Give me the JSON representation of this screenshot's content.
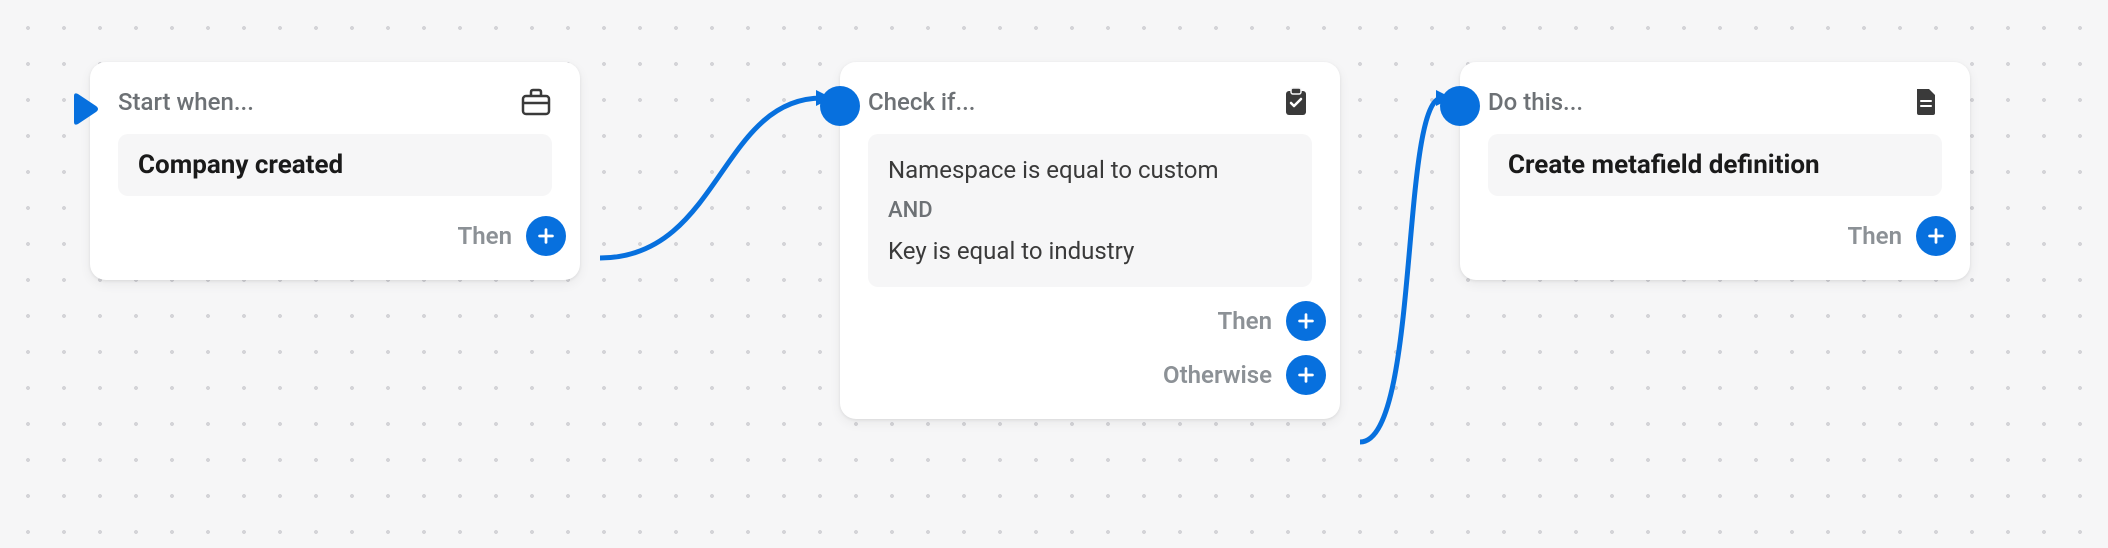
{
  "trigger": {
    "header": "Start when...",
    "title": "Company created",
    "then": "Then"
  },
  "condition": {
    "header": "Check if...",
    "line1": "Namespace is equal to custom",
    "and": "AND",
    "line2": "Key is equal to industry",
    "then": "Then",
    "otherwise": "Otherwise"
  },
  "action": {
    "header": "Do this...",
    "title": "Create metafield definition",
    "then": "Then"
  }
}
